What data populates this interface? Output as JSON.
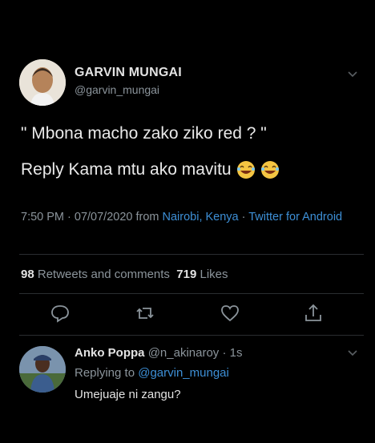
{
  "tweet": {
    "author_name": "GARVIN MUNGAI",
    "author_handle": "@garvin_mungai",
    "line1": "\" Mbona macho zako ziko red ? \"",
    "line2": "Reply Kama mtu ako mavitu",
    "emoji": [
      "laughing-emoji",
      "laughing-emoji"
    ],
    "meta_prefix": "7:50 PM · 07/07/2020 from ",
    "location": "Nairobi, Kenya",
    "meta_sep": " · ",
    "client": "Twitter for Android",
    "retweets_count": "98",
    "retweets_label": "Retweets and comments",
    "likes_count": "719",
    "likes_label": "Likes"
  },
  "actions": [
    "reply-icon",
    "retweet-icon",
    "like-icon",
    "share-icon"
  ],
  "reply": {
    "name": "Anko Poppa",
    "handle": "@n_akinaroy",
    "sep": " · ",
    "time": "1s",
    "replying_label": "Replying to ",
    "replying_to": "@garvin_mungai",
    "text": "Umejuaje ni zangu?"
  },
  "colors": {
    "background": "#000000",
    "link": "#3d8fd6",
    "muted": "#8b949b",
    "text": "#e3e3e3"
  }
}
